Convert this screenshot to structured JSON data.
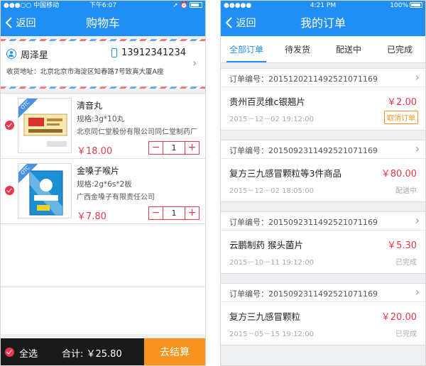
{
  "cart_screen": {
    "status": {
      "carrier": "●●●○○ 中国移动",
      "time": "下午6:07",
      "right": "➚ ⏰"
    },
    "nav": {
      "back_label": "返回",
      "title": "购物车"
    },
    "address": {
      "name": "周泽星",
      "phone": "13912341234",
      "address_line": "收货地址：北京北京市海淀区知春路7号致真大厦A座"
    },
    "items": [
      {
        "badge": "OTC",
        "name": "清音丸",
        "spec": "规格:3g*10丸",
        "maker": "北京同仁堂股份有限公司同仁堂制药厂",
        "price": "￥18.00",
        "quantity": "1",
        "minus": "−",
        "plus": "+"
      },
      {
        "badge": "OTC",
        "name": "金嗓子喉片",
        "spec": "规格:2g*6s*2板",
        "maker": "广西金嗓子有限责任公司",
        "price": "￥7.80",
        "quantity": "1",
        "minus": "−",
        "plus": "+"
      }
    ],
    "footer": {
      "select_all": "全选",
      "total": "合计: ￥25.80",
      "checkout": "去结算"
    }
  },
  "orders_screen": {
    "status": {
      "carrier": "●●●●● ",
      "time": "4:21 PM",
      "battery": "100%"
    },
    "nav": {
      "back_label": "返回",
      "title": "我的订单"
    },
    "tabs": [
      {
        "label": "全部订单"
      },
      {
        "label": "待发货"
      },
      {
        "label": "配送中"
      },
      {
        "label": "已完成"
      }
    ],
    "orders": [
      {
        "order_no": "订单编号：201512021149252107116​9",
        "name": "贵州百灵维c银翘片",
        "price": "￥2.00",
        "time": "2015－12－02  19:12:00",
        "action": "取消订单"
      },
      {
        "order_no": "订单编号：2015092311492521071169",
        "name": "复方三九感冒颗粒等3件商品",
        "price": "￥80.00",
        "time": "2015－12－02  18:05:00",
        "status": "配送中"
      },
      {
        "order_no": "订单编号：2015092311492521071169",
        "name": "云鹏制药 猴头菌片",
        "price": "￥5.30",
        "time": "2015－10－11  19:12:00",
        "status": "已完成"
      },
      {
        "order_no": "订单编号：2015092311492521071169",
        "name": "复方三九感冒颗粒",
        "price": "￥20.00",
        "time": "2015－05－15  19:12:00",
        "status": "已完成"
      }
    ]
  },
  "colors": {
    "primary": "#1f8ff5",
    "price_red": "#e8384f",
    "checkout_orange": "#f7941d",
    "bottom_bar": "#1a1a1a"
  }
}
